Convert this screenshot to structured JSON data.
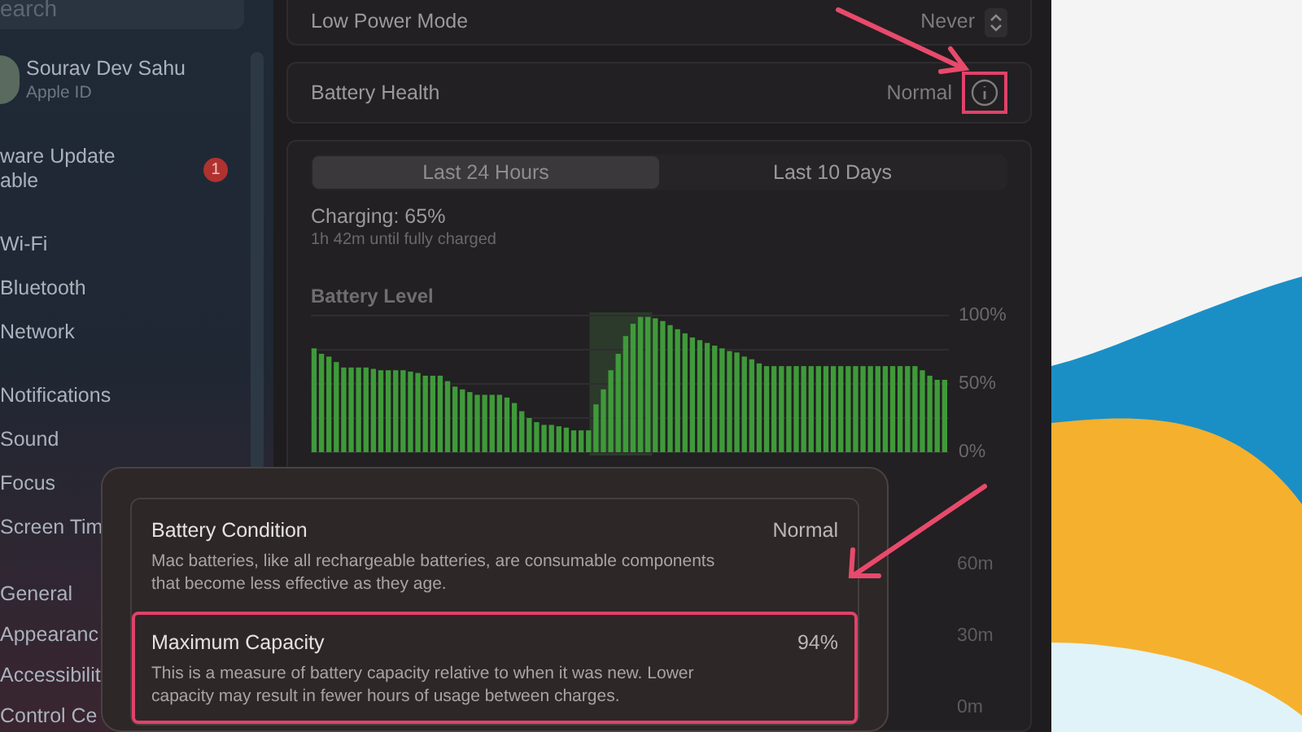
{
  "sidebar": {
    "search": {
      "placeholder": "earch"
    },
    "profile": {
      "name": "Sourav Dev Sahu",
      "subtitle": "Apple ID"
    },
    "update": {
      "lines": [
        "ware Update",
        "able"
      ],
      "badge": "1"
    },
    "groups": [
      [
        {
          "label": "Wi-Fi"
        },
        {
          "label": "Bluetooth"
        },
        {
          "label": "Network"
        }
      ],
      [
        {
          "label": "Notifications"
        },
        {
          "label": "Sound"
        },
        {
          "label": "Focus"
        },
        {
          "label": "Screen Tim"
        }
      ],
      [
        {
          "label": "General"
        },
        {
          "label": "Appearanc"
        },
        {
          "label": "Accessibilit"
        },
        {
          "label": "Control Ce"
        }
      ]
    ]
  },
  "settings": [
    {
      "label": "Low Power Mode",
      "value": "Never",
      "kind": "stepper",
      "highlighted": false
    },
    {
      "label": "Battery Health",
      "value": "Normal",
      "kind": "info",
      "highlighted": true
    }
  ],
  "history": {
    "tabs": [
      {
        "label": "Last 24 Hours",
        "selected": true
      },
      {
        "label": "Last 10 Days",
        "selected": false
      }
    ],
    "status": "Charging: 65%",
    "substatus": "1h 42m until fully charged",
    "chart_data": {
      "type": "bar",
      "ylim": [
        0,
        100
      ],
      "yticks": [
        {
          "value": 0,
          "label": "0%"
        },
        {
          "value": 50,
          "label": "50%"
        },
        {
          "value": 100,
          "label": "100%"
        }
      ],
      "series": [
        {
          "name": "Battery Level",
          "color": "#3f9a3a",
          "values": [
            76,
            72,
            70,
            66,
            62,
            62,
            62,
            62,
            61,
            60,
            60,
            60,
            60,
            59,
            58,
            56,
            56,
            56,
            52,
            48,
            46,
            44,
            42,
            42,
            42,
            42,
            40,
            36,
            30,
            25,
            22,
            20,
            20,
            19,
            18,
            16,
            16,
            16,
            35,
            46,
            60,
            72,
            85,
            94,
            99,
            99,
            98,
            96,
            93,
            90,
            87,
            84,
            82,
            80,
            78,
            76,
            74,
            73,
            70,
            68,
            65,
            63,
            63,
            63,
            63,
            63,
            63,
            63,
            63,
            63,
            63,
            63,
            63,
            63,
            63,
            63,
            63,
            63,
            63,
            63,
            63,
            63,
            60,
            56,
            53,
            53
          ]
        }
      ]
    },
    "usage_ticks": [
      "60m",
      "30m",
      "0m"
    ]
  },
  "popup": {
    "rows": [
      {
        "title": "Battery Condition",
        "value": "Normal",
        "description": "Mac batteries, like all rechargeable batteries, are consumable components that become less effective as they age.",
        "highlighted": false
      },
      {
        "title": "Maximum Capacity",
        "value": "94%",
        "description": "This is a measure of battery capacity relative to when it was new. Lower capacity may result in fewer hours of usage between charges.",
        "highlighted": true
      }
    ]
  }
}
